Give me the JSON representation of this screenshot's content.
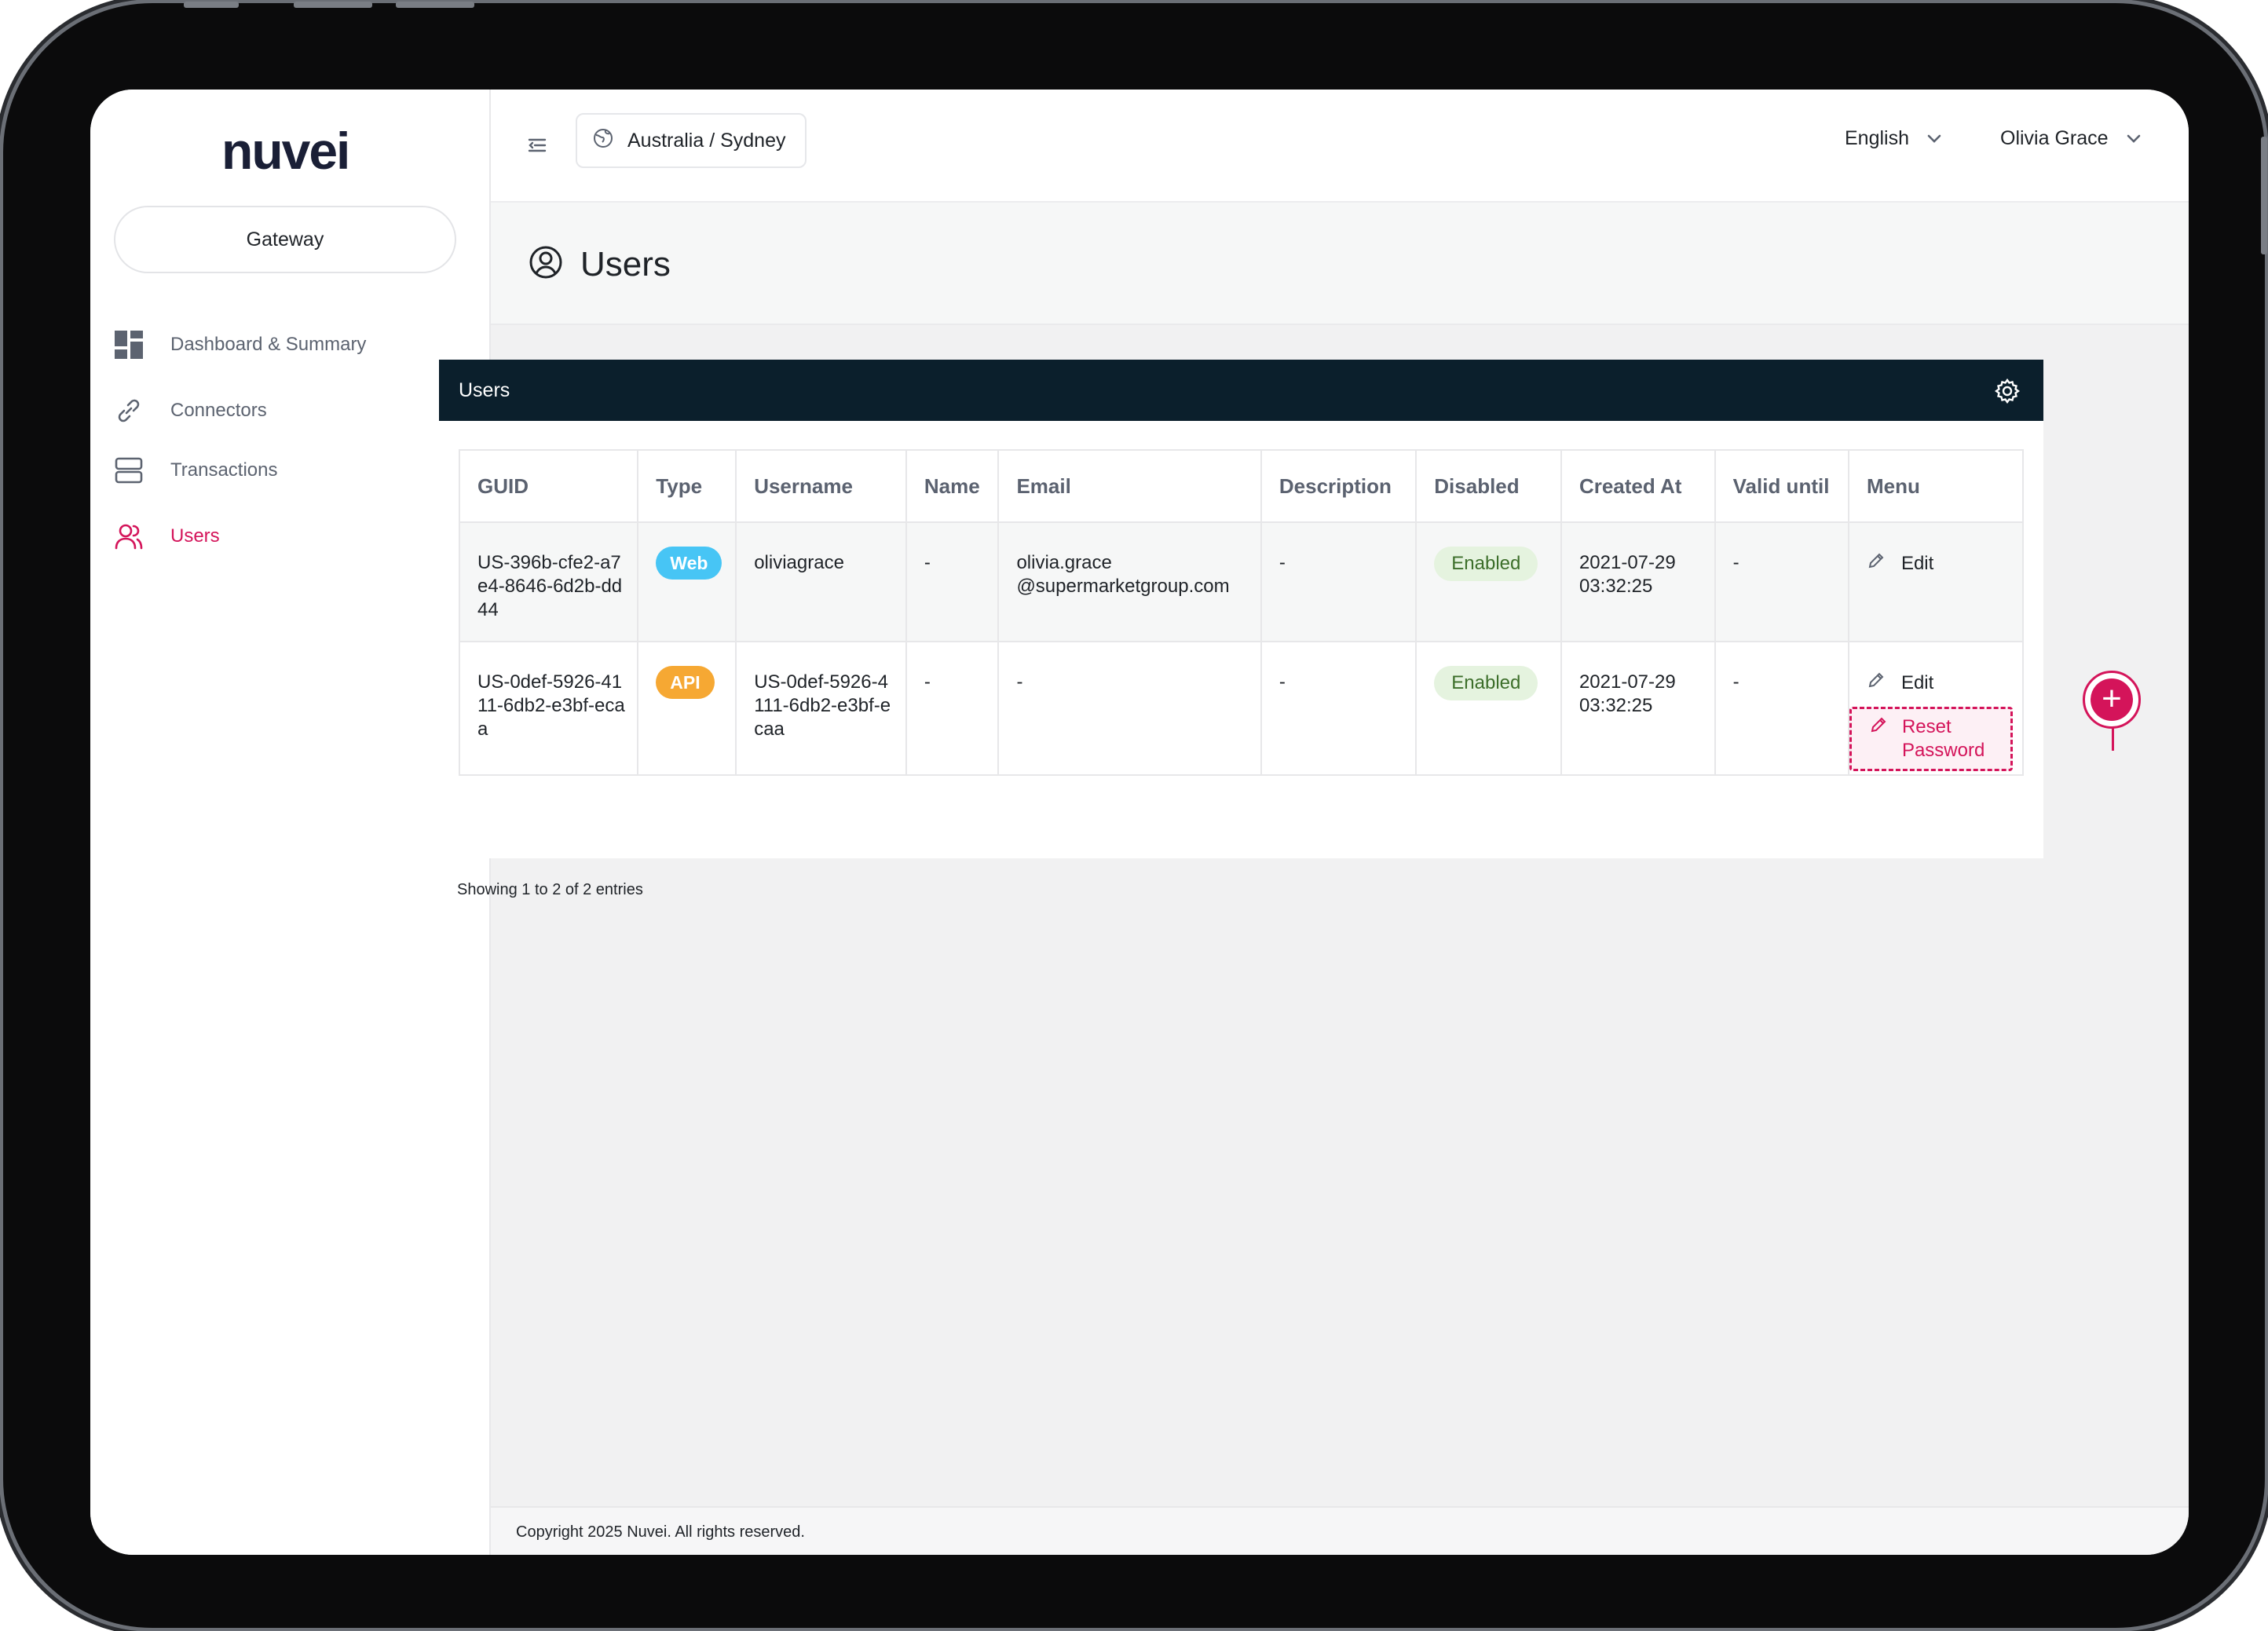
{
  "brand": {
    "logo_text": "nuvei",
    "accent": "#e4005b"
  },
  "sidebar": {
    "gateway_label": "Gateway",
    "items": [
      {
        "label": "Dashboard & Summary",
        "icon": "dashboard-icon"
      },
      {
        "label": "Connectors",
        "icon": "link-icon"
      },
      {
        "label": "Transactions",
        "icon": "stack-icon",
        "has_submenu": true
      },
      {
        "label": "Users",
        "icon": "users-icon",
        "active": true
      }
    ]
  },
  "topbar": {
    "timezone": "Australia / Sydney",
    "language": "English",
    "user_name": "Olivia Grace"
  },
  "page": {
    "title": "Users"
  },
  "card": {
    "title": "Users",
    "columns": [
      "GUID",
      "Type",
      "Username",
      "Name",
      "Email",
      "Description",
      "Disabled",
      "Created At",
      "Valid until",
      "Menu"
    ],
    "rows": [
      {
        "guid": "US-396b-cfe2-a7e4-8646-6d2b-dd44",
        "type": "Web",
        "username": "oliviagrace",
        "name": "-",
        "email_line1": "olivia.grace",
        "email_line2": "@supermarketgroup.com",
        "description": "-",
        "disabled": "Enabled",
        "created_date": "2021-07-29",
        "created_time": "03:32:25",
        "valid_until": "-",
        "menu_edit": "Edit"
      },
      {
        "guid": "US-0def-5926-4111-6db2-e3bf-ecaa",
        "type": "API",
        "username": "US-0def-5926-4111-6db2-e3bf-ecaa",
        "name": "-",
        "email": "-",
        "description": "-",
        "disabled": "Enabled",
        "created_date": "2021-07-29",
        "created_time": "03:32:25",
        "valid_until": "-",
        "menu_edit": "Edit",
        "menu_reset_line1": "Reset",
        "menu_reset_line2": "Password"
      }
    ],
    "entries_text": "Showing 1 to 2 of 2 entries"
  },
  "footer": {
    "copyright": "Copyright 2025 Nuvei. All rights reserved."
  },
  "colors": {
    "dark_header": "#0b1f2c",
    "web_badge": "#47c5f5",
    "api_badge": "#f6a833",
    "enabled_bg": "#e5f3df",
    "highlight": "#d4145a"
  }
}
